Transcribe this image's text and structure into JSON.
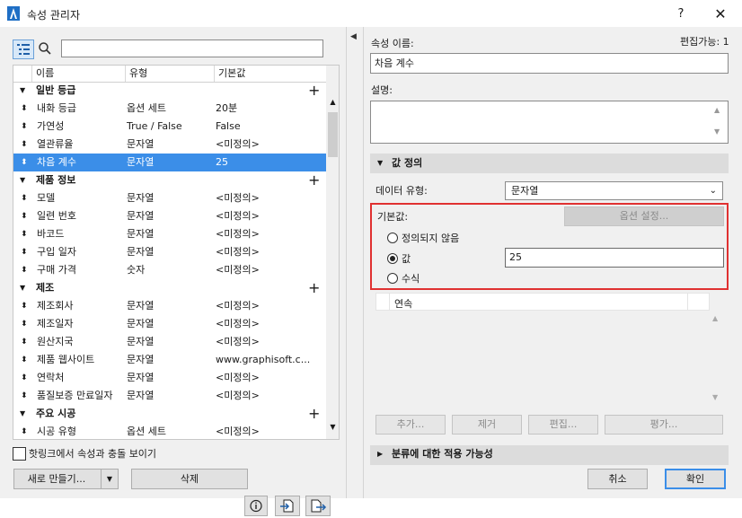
{
  "window": {
    "title": "속성 관리자",
    "help": "?",
    "close": "✕"
  },
  "left": {
    "search_placeholder": "",
    "columns": [
      "이름",
      "유형",
      "기본값"
    ],
    "rows": [
      {
        "kind": "group",
        "label": "일반 등급"
      },
      {
        "kind": "item",
        "name": "내화 등급",
        "type": "옵션 세트",
        "default": "20분"
      },
      {
        "kind": "item",
        "name": "가연성",
        "type": "True / False",
        "default": "False"
      },
      {
        "kind": "item",
        "name": "열관류율",
        "type": "문자열",
        "default": "<미정의>"
      },
      {
        "kind": "item",
        "name": "차음 계수",
        "type": "문자열",
        "default": "25",
        "selected": true
      },
      {
        "kind": "group",
        "label": "제품 정보"
      },
      {
        "kind": "item",
        "name": "모델",
        "type": "문자열",
        "default": "<미정의>"
      },
      {
        "kind": "item",
        "name": "일련 번호",
        "type": "문자열",
        "default": "<미정의>"
      },
      {
        "kind": "item",
        "name": "바코드",
        "type": "문자열",
        "default": "<미정의>"
      },
      {
        "kind": "item",
        "name": "구입 일자",
        "type": "문자열",
        "default": "<미정의>"
      },
      {
        "kind": "item",
        "name": "구매 가격",
        "type": "숫자",
        "default": "<미정의>"
      },
      {
        "kind": "group",
        "label": "제조"
      },
      {
        "kind": "item",
        "name": "제조회사",
        "type": "문자열",
        "default": "<미정의>"
      },
      {
        "kind": "item",
        "name": "제조일자",
        "type": "문자열",
        "default": "<미정의>"
      },
      {
        "kind": "item",
        "name": "원산지국",
        "type": "문자열",
        "default": "<미정의>"
      },
      {
        "kind": "item",
        "name": "제품 웹사이트",
        "type": "문자열",
        "default": "www.graphisoft.c..."
      },
      {
        "kind": "item",
        "name": "연락처",
        "type": "문자열",
        "default": "<미정의>"
      },
      {
        "kind": "item",
        "name": "품질보증 만료일자",
        "type": "문자열",
        "default": "<미정의>"
      },
      {
        "kind": "group",
        "label": "주요 시공"
      },
      {
        "kind": "item",
        "name": "시공 유형",
        "type": "옵션 세트",
        "default": "<미정의>"
      }
    ],
    "hotlink_label": "핫링크에서 속성과 충돌 보이기",
    "new_label": "새로 만들기...",
    "delete_label": "삭제",
    "info_icon": "ⓘ"
  },
  "right": {
    "name_label": "속성 이름:",
    "editable_label": "편집가능: 1",
    "name_value": "차음 계수",
    "desc_label": "설명:",
    "value_def_label": "값 정의",
    "datatype_label": "데이터 유형:",
    "datatype_value": "문자열",
    "default_label": "기본값:",
    "option_setting_label": "옵션 설정...",
    "radio_undefined": "정의되지 않음",
    "radio_value": "값",
    "value_input": "25",
    "radio_formula": "수식",
    "list_column": "연속",
    "add_label": "추가...",
    "remove_label": "제거",
    "edit_label": "편집...",
    "eval_label": "평가...",
    "classification_label": "분류에 대한 적용 가능성",
    "cancel_label": "취소",
    "ok_label": "확인"
  },
  "colors": {
    "selection": "#3b8ee8",
    "highlight_border": "#e03131"
  }
}
